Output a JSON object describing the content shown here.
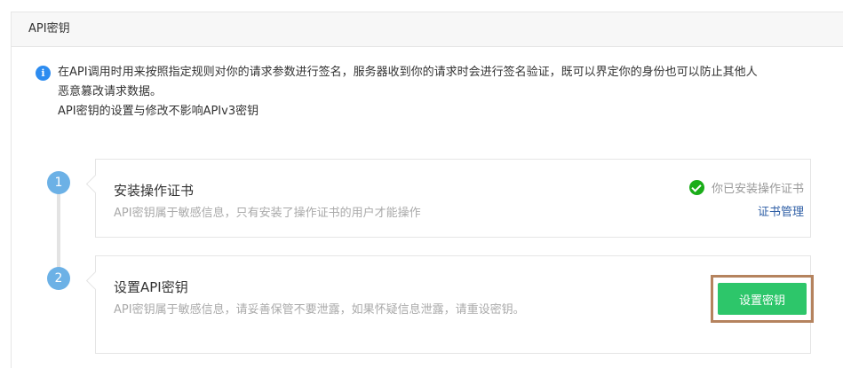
{
  "panel": {
    "title": "API密钥"
  },
  "notice": {
    "icon": "info-icon",
    "line1": "在API调用时用来按照指定规则对你的请求参数进行签名，服务器收到你的请求时会进行签名验证，既可以界定你的身份也可以防止其他人",
    "line2": "恶意篡改请求数据。",
    "line3": "API密钥的设置与修改不影响APIv3密钥"
  },
  "steps": [
    {
      "number": "1",
      "title": "安装操作证书",
      "desc": "API密钥属于敏感信息，只有安装了操作证书的用户才能操作",
      "status_text": "你已安装操作证书",
      "link_text": "证书管理"
    },
    {
      "number": "2",
      "title": "设置API密钥",
      "desc": "API密钥属于敏感信息，请妥善保管不要泄露，如果怀疑信息泄露，请重设密钥。",
      "button_label": "设置密钥"
    }
  ],
  "colors": {
    "accent_green": "#2dc66a",
    "step_blue": "#6cb1e6",
    "link_blue": "#2f5fa6",
    "highlight_border": "#b5835e"
  }
}
